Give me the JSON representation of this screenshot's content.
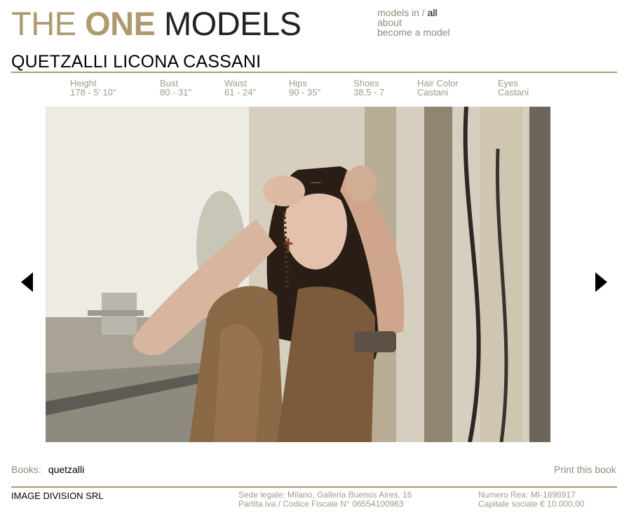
{
  "logo": {
    "part1": "THE ",
    "part2": "ONE",
    "part3": " MODELS"
  },
  "nav": {
    "models_in": "models in",
    "separator": " / ",
    "all": "all",
    "about": "about",
    "become": "become a model"
  },
  "model": {
    "name": "QUETZALLI LICONA CASSANI"
  },
  "stats": [
    {
      "label": "Height",
      "value": "178 - 5' 10\""
    },
    {
      "label": "Bust",
      "value": "80 - 31\""
    },
    {
      "label": "Waist",
      "value": "61 - 24\""
    },
    {
      "label": "Hips",
      "value": "90 - 35\""
    },
    {
      "label": "Shoes",
      "value": "38,5 - 7"
    },
    {
      "label": "Hair Color",
      "value": "Castani"
    },
    {
      "label": "Eyes",
      "value": "Castani"
    }
  ],
  "books": {
    "label": "Books:",
    "item": "quetzalli"
  },
  "print": "Print this book",
  "footer": {
    "company": "IMAGE DIVISION SRL",
    "address1": "Sede legale: Milano, Galleria Buenos Aires, 16",
    "address2": "Partita iva / Codice Fiscale N° 06554100963",
    "rea": "Numero Rea: MI-1898917",
    "capital": "Capitale sociale € 10.000,00"
  },
  "colors": {
    "accent": "#ad9a6f",
    "muted": "#a09a8a"
  },
  "icons": {
    "prev": "triangle-left-icon",
    "next": "triangle-right-icon"
  }
}
